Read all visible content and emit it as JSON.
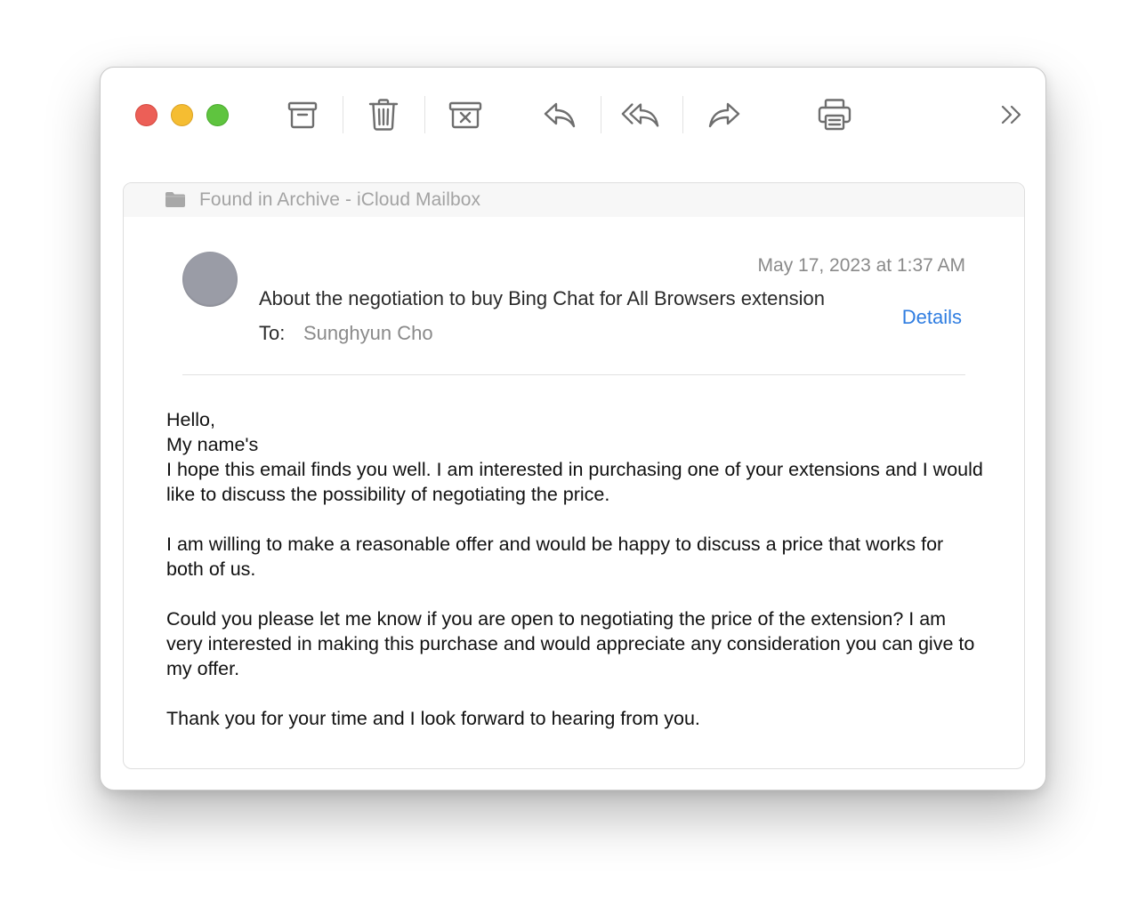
{
  "toolbar": {
    "buttons": [
      {
        "name": "archive-icon"
      },
      {
        "name": "trash-icon"
      },
      {
        "name": "junk-icon"
      },
      {
        "name": "reply-icon"
      },
      {
        "name": "reply-all-icon"
      },
      {
        "name": "forward-icon"
      },
      {
        "name": "print-icon"
      },
      {
        "name": "chevron-double-right-icon"
      }
    ]
  },
  "banner": {
    "icon": "folder-icon",
    "text": "Found in Archive - iCloud Mailbox"
  },
  "message": {
    "date": "May 17, 2023 at 1:37 AM",
    "subject": "About the negotiation to buy Bing Chat for All Browsers extension",
    "details_label": "Details",
    "to_label": "To:",
    "to_value": "Sunghyun Cho",
    "body": {
      "line1": "Hello,",
      "line2": "My name's",
      "para1": "I hope this email finds you well. I am interested in purchasing one of your extensions and I would like to discuss the possibility of negotiating the price.",
      "para2": "I am willing to make a reasonable offer and would be happy to discuss a price that works for both of us.",
      "para3": "Could you please let me know if you are open to negotiating the price of the extension? I am very interested in making this purchase and would appreciate any consideration you can give to my offer.",
      "para4": "Thank you for your time and I look forward to hearing from you."
    }
  },
  "colors": {
    "close": "#ec5f57",
    "minimize": "#f5bd32",
    "maximize": "#5fc43f",
    "link": "#2f7de1",
    "avatar": "#9a9ca6"
  }
}
